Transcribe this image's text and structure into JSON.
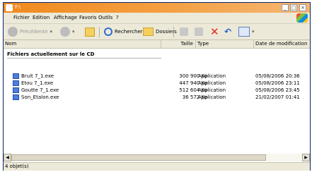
{
  "window": {
    "title": "F:\\"
  },
  "menu": [
    "Fichier",
    "Edition",
    "Affichage",
    "Favoris",
    "Outils",
    "?"
  ],
  "toolbar": {
    "back_label": "Précédente",
    "search_label": "Rechercher",
    "folders_label": "Dossiers"
  },
  "columns": {
    "name": "Nom",
    "size": "Taille",
    "type": "Type",
    "date": "Date de modification"
  },
  "group_title": "Fichiers actuellement sur le CD",
  "files": [
    {
      "name": "Bruit 7_1.exe",
      "size": "300 900 Ko",
      "type": "Application",
      "date": "05/08/2006 20:36"
    },
    {
      "name": "Etou 7_1.exe",
      "size": "447 940 Ko",
      "type": "Application",
      "date": "05/08/2006 23:11"
    },
    {
      "name": "Goutte 7_1.exe",
      "size": "512 604 Ko",
      "type": "Application",
      "date": "05/08/2006 23:45"
    },
    {
      "name": "Son_Etalon.exe",
      "size": "36 572 Ko",
      "type": "Application",
      "date": "21/02/2007 01:41"
    }
  ],
  "status": "4 objet(s)",
  "colors": {
    "title_bar": "#f08a1e",
    "chrome": "#ece9d8",
    "file_icon": "#4f7ee0"
  }
}
